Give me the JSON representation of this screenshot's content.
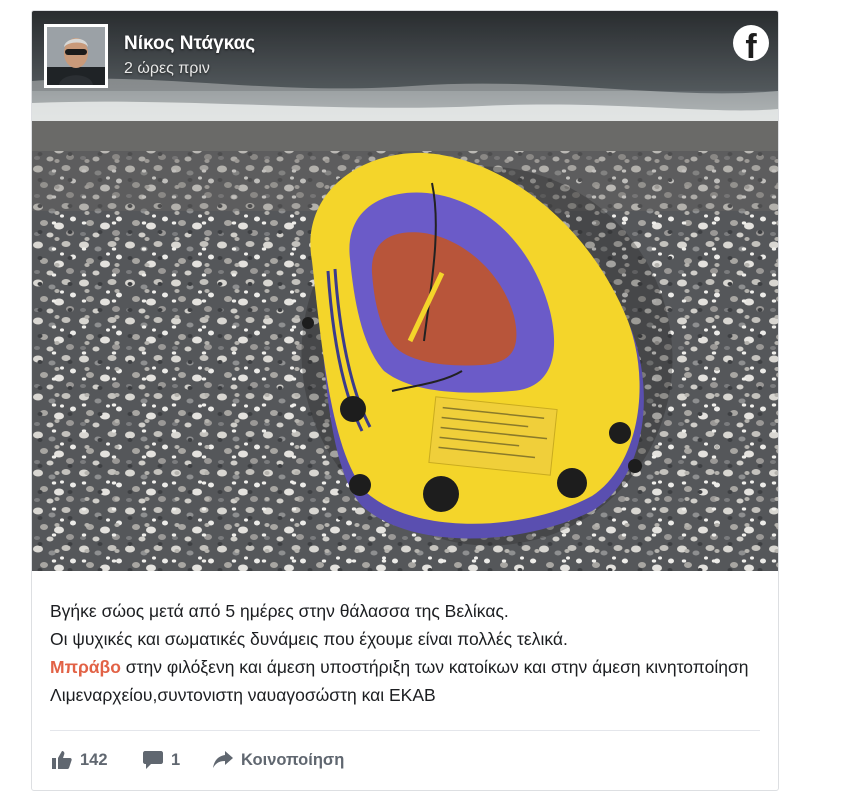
{
  "post": {
    "author": "Νίκος Ντάγκας",
    "timestamp": "2 ώρες πριν",
    "text_line1": "Βγήκε σώος μετά από 5 ημέρες στην θάλασσα της Βελίκας.",
    "text_line2": "Οι ψυχικές και σωματικές δυνάμεις που έχουμε είναι πολλές τελικά.",
    "text_highlight": "Μπράβο",
    "text_line3_rest": " στην φιλόξενη και άμεση υποστήριξη των κατοίκων και στην άμεση κινητοποίηση Λιμεναρχείου,συντονιστη ναυαγοσώστη και ΕΚΑΒ",
    "image_alt": "Κίτρινη φουσκωτή βάρκα σε βοτσαλωτή παραλία"
  },
  "stats": {
    "likes": "142",
    "comments": "1",
    "share_label": "Κοινοποίηση"
  },
  "icons": {
    "network": "facebook-icon",
    "like": "thumbs-up-icon",
    "comment": "comment-icon",
    "share": "share-arrow-icon"
  },
  "colors": {
    "highlight": "#e26246",
    "action_text": "#606770",
    "boat_yellow": "#f4d52a",
    "boat_purple": "#5a4fb0"
  }
}
